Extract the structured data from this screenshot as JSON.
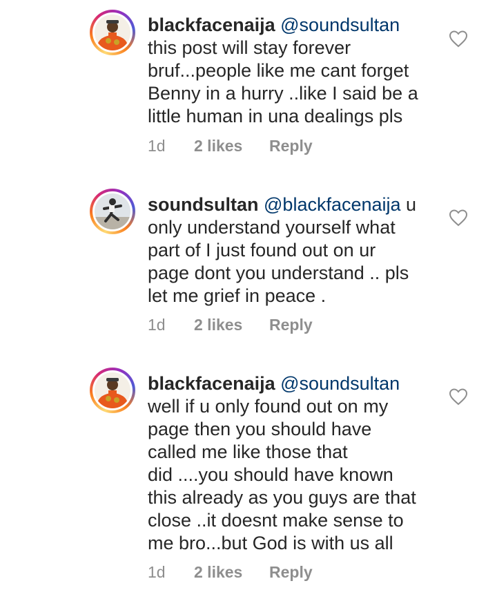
{
  "comments": [
    {
      "username": "blackfacenaija",
      "mention": "@soundsultan",
      "text": "this post will stay forever\nbruf...people like me cant forget\nBenny in a hurry ..like I said be a\nlittle human in una dealings pls",
      "time": "1d",
      "likes": "2 likes",
      "reply": "Reply",
      "avatar": "orange-outfit-avatar"
    },
    {
      "username": "soundsultan",
      "mention": "@blackfacenaija",
      "text": " u\nonly understand yourself what\npart of I just found out on ur\npage dont you understand .. pls\nlet me grief in peace .",
      "time": "1d",
      "likes": "2 likes",
      "reply": "Reply",
      "avatar": "dancing-figure-avatar"
    },
    {
      "username": "blackfacenaija",
      "mention": "@soundsultan",
      "text": "well if u only found out on my\npage then you should have\ncalled me like those that\ndid ....you should have known\nthis already as you guys are that\nclose ..it doesnt make sense to\nme bro...but God is with us all",
      "time": "1d",
      "likes": "2 likes",
      "reply": "Reply",
      "avatar": "orange-outfit-avatar"
    }
  ],
  "colors": {
    "text": "#262626",
    "mention": "#00376b",
    "meta": "#8e8e8e"
  }
}
